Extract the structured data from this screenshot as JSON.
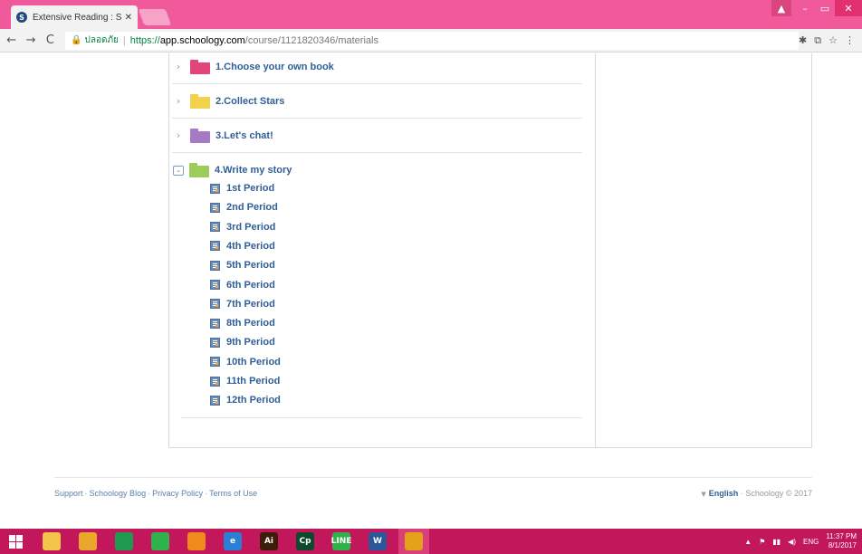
{
  "browser": {
    "tab_title": "Extensive Reading : Secti",
    "tab_close": "✕",
    "favicon": "S",
    "secure_label": "ปลอดภัย",
    "url_scheme": "https://",
    "url_host": "app.schoology.com",
    "url_path": "/course/1121820346/materials",
    "nav": {
      "back": "←",
      "forward": "→",
      "reload": "C"
    },
    "window": {
      "user": "▲",
      "minimize": "–",
      "maximize": "▭",
      "close": "✕"
    },
    "ext_icons": [
      "puzzle-icon",
      "translate-icon",
      "star-icon",
      "menu-icon"
    ]
  },
  "materials": {
    "folders": [
      {
        "label": "1.Choose your own book",
        "color": "#e2457a",
        "expanded": false
      },
      {
        "label": "2.Collect Stars",
        "color": "#f2d14d",
        "expanded": false
      },
      {
        "label": "3.Let's chat!",
        "color": "#a77ac6",
        "expanded": false
      },
      {
        "label": "4.Write my story",
        "color": "#9ccc5a",
        "expanded": true
      }
    ],
    "periods": [
      "1st Period",
      "2nd Period",
      "3rd Period",
      "4th Period",
      "5th Period",
      "6th Period",
      "7th Period",
      "8th Period",
      "9th Period",
      "10th Period",
      "11th Period",
      "12th Period"
    ]
  },
  "footer": {
    "links": [
      "Support",
      "Schoology Blog",
      "Privacy Policy",
      "Terms of Use"
    ],
    "separator": "·",
    "language": "English",
    "copyright": "Schoology © 2017"
  },
  "taskbar": {
    "apps": [
      {
        "name": "file-explorer-icon",
        "label": "",
        "color": "#f3c54a"
      },
      {
        "name": "app-yellow-icon",
        "label": "",
        "color": "#e9a72c"
      },
      {
        "name": "store-icon",
        "label": "",
        "color": "#1e9a4e"
      },
      {
        "name": "chat-icon",
        "label": "",
        "color": "#2fb24c"
      },
      {
        "name": "game-icon",
        "label": "",
        "color": "#f08a1c"
      },
      {
        "name": "internet-explorer-icon",
        "label": "e",
        "color": "#2a7fd4"
      },
      {
        "name": "illustrator-icon",
        "label": "Ai",
        "color": "#3d1d0a"
      },
      {
        "name": "captivate-icon",
        "label": "Cp",
        "color": "#0d4a2d"
      },
      {
        "name": "line-icon",
        "label": "LINE",
        "color": "#2fb24c"
      },
      {
        "name": "word-icon",
        "label": "W",
        "color": "#2b579a"
      },
      {
        "name": "chrome-icon",
        "label": "",
        "color": "#e3a21a"
      }
    ],
    "tray_lang": "ENG",
    "time": "11:37 PM",
    "date": "8/1/2017"
  }
}
